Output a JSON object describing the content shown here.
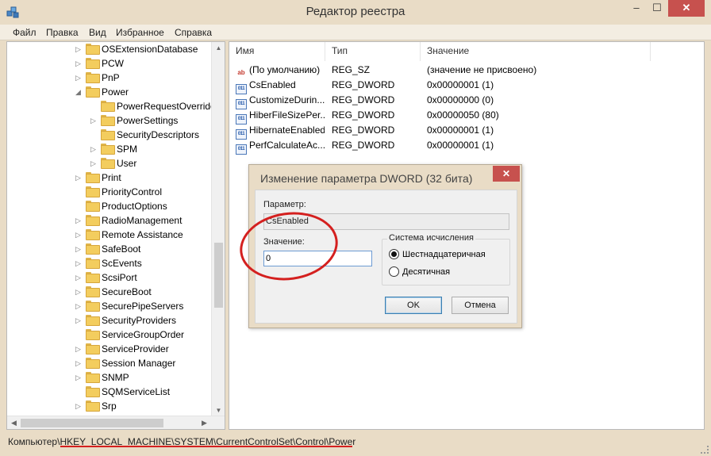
{
  "window": {
    "title": "Редактор реестра",
    "minimize_glyph": "–",
    "maximize_glyph": "☐",
    "close_glyph": "✕"
  },
  "menu": [
    "Файл",
    "Правка",
    "Вид",
    "Избранное",
    "Справка"
  ],
  "tree": {
    "items": [
      {
        "label": "OSExtensionDatabase",
        "depth": 0,
        "expander": "▷"
      },
      {
        "label": "PCW",
        "depth": 0,
        "expander": "▷"
      },
      {
        "label": "PnP",
        "depth": 0,
        "expander": "▷"
      },
      {
        "label": "Power",
        "depth": 0,
        "expander": "◢"
      },
      {
        "label": "PowerRequestOverride",
        "depth": 1,
        "expander": ""
      },
      {
        "label": "PowerSettings",
        "depth": 1,
        "expander": "▷"
      },
      {
        "label": "SecurityDescriptors",
        "depth": 1,
        "expander": ""
      },
      {
        "label": "SPM",
        "depth": 1,
        "expander": "▷"
      },
      {
        "label": "User",
        "depth": 1,
        "expander": "▷"
      },
      {
        "label": "Print",
        "depth": 0,
        "expander": "▷"
      },
      {
        "label": "PriorityControl",
        "depth": 0,
        "expander": ""
      },
      {
        "label": "ProductOptions",
        "depth": 0,
        "expander": ""
      },
      {
        "label": "RadioManagement",
        "depth": 0,
        "expander": "▷"
      },
      {
        "label": "Remote Assistance",
        "depth": 0,
        "expander": "▷"
      },
      {
        "label": "SafeBoot",
        "depth": 0,
        "expander": "▷"
      },
      {
        "label": "ScEvents",
        "depth": 0,
        "expander": "▷"
      },
      {
        "label": "ScsiPort",
        "depth": 0,
        "expander": "▷"
      },
      {
        "label": "SecureBoot",
        "depth": 0,
        "expander": "▷"
      },
      {
        "label": "SecurePipeServers",
        "depth": 0,
        "expander": "▷"
      },
      {
        "label": "SecurityProviders",
        "depth": 0,
        "expander": "▷"
      },
      {
        "label": "ServiceGroupOrder",
        "depth": 0,
        "expander": ""
      },
      {
        "label": "ServiceProvider",
        "depth": 0,
        "expander": "▷"
      },
      {
        "label": "Session Manager",
        "depth": 0,
        "expander": "▷"
      },
      {
        "label": "SNMP",
        "depth": 0,
        "expander": "▷"
      },
      {
        "label": "SQMServiceList",
        "depth": 0,
        "expander": ""
      },
      {
        "label": "Srp",
        "depth": 0,
        "expander": "▷"
      }
    ]
  },
  "list": {
    "columns": [
      "Имя",
      "Тип",
      "Значение"
    ],
    "rows": [
      {
        "icon": "string-value-icon",
        "icon_glyph": "ab",
        "name": "(По умолчанию)",
        "type": "REG_SZ",
        "value": "(значение не присвоено)"
      },
      {
        "icon": "binary-value-icon",
        "icon_glyph": "011",
        "name": "CsEnabled",
        "type": "REG_DWORD",
        "value": "0x00000001 (1)"
      },
      {
        "icon": "binary-value-icon",
        "icon_glyph": "011",
        "name": "CustomizeDurin...",
        "type": "REG_DWORD",
        "value": "0x00000000 (0)"
      },
      {
        "icon": "binary-value-icon",
        "icon_glyph": "011",
        "name": "HiberFileSizePer...",
        "type": "REG_DWORD",
        "value": "0x00000050 (80)"
      },
      {
        "icon": "binary-value-icon",
        "icon_glyph": "011",
        "name": "HibernateEnabled",
        "type": "REG_DWORD",
        "value": "0x00000001 (1)"
      },
      {
        "icon": "binary-value-icon",
        "icon_glyph": "011",
        "name": "PerfCalculateAc...",
        "type": "REG_DWORD",
        "value": "0x00000001 (1)"
      }
    ]
  },
  "dialog": {
    "title": "Изменение параметра DWORD (32 бита)",
    "close_glyph": "✕",
    "param_label": "Параметр:",
    "param_value": "CsEnabled",
    "value_label": "Значение:",
    "value_input": "0",
    "base_group": "Система исчисления",
    "radio_hex": "Шестнадцатеричная",
    "radio_dec": "Десятичная",
    "ok_label": "OK",
    "cancel_label": "Отмена"
  },
  "status": {
    "path": "Компьютер\\HKEY_LOCAL_MACHINE\\SYSTEM\\CurrentControlSet\\Control\\Power"
  },
  "colors": {
    "annotation": "#d4201f",
    "close_button": "#c7514e",
    "window_frame": "#e9dcc6"
  }
}
